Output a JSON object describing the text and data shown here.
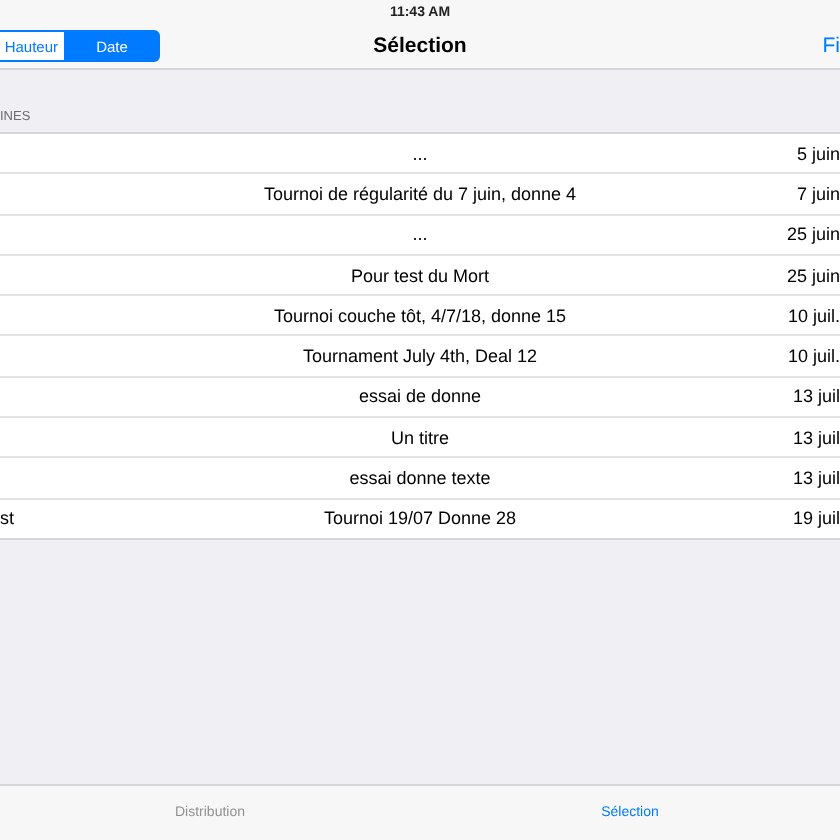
{
  "status_bar": {
    "time": "11:43 AM"
  },
  "nav_bar": {
    "segments": [
      {
        "label": "Hauteur",
        "selected": false
      },
      {
        "label": "Date",
        "selected": true
      }
    ],
    "title": "Sélection",
    "right_button": "Fi"
  },
  "section": {
    "header": "INES"
  },
  "rows": [
    {
      "title": "...",
      "date": "5 juin"
    },
    {
      "title": "Tournoi de régularité du 7 juin, donne 4",
      "date": "7 juin"
    },
    {
      "title": "...",
      "date": "25 juin"
    },
    {
      "title": "Pour test du Mort",
      "date": "25 juin"
    },
    {
      "title": "Tournoi couche tôt, 4/7/18, donne 15",
      "date": "10 juil."
    },
    {
      "title": "Tournament July 4th, Deal 12",
      "date": "10 juil."
    },
    {
      "title": "essai de donne",
      "date": "13 juil"
    },
    {
      "title": "Un titre",
      "date": "13 juil"
    },
    {
      "title": "essai donne texte",
      "date": "13 juil"
    },
    {
      "column_1": "st",
      "title": "Tournoi 19/07 Donne 28",
      "date": "19 juil"
    }
  ],
  "tab_bar": [
    {
      "label": "Distribution",
      "selected": false
    },
    {
      "label": "Sélection",
      "selected": true
    }
  ]
}
